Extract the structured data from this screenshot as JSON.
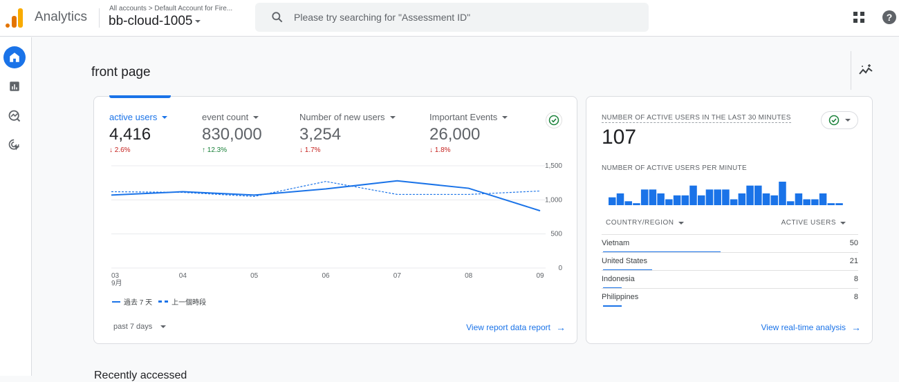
{
  "header": {
    "app_name": "Analytics",
    "breadcrumb": "All accounts > Default Account for Fire...",
    "property": "bb-cloud-1005",
    "search_placeholder": "Please try searching for \"Assessment ID\"",
    "icons": [
      "analytics-logo",
      "search-icon",
      "apps-icon",
      "help-icon"
    ]
  },
  "sidenav": {
    "items": [
      {
        "name": "home",
        "icon": "home-icon",
        "active": true
      },
      {
        "name": "reports",
        "icon": "bar-chart-icon",
        "active": false
      },
      {
        "name": "explore",
        "icon": "explore-icon",
        "active": false
      },
      {
        "name": "advertising",
        "icon": "target-cursor-icon",
        "active": false
      }
    ]
  },
  "page": {
    "title": "front page",
    "recent_heading": "Recently accessed"
  },
  "overview_card": {
    "metrics": [
      {
        "label": "active users",
        "value": "4,416",
        "delta": "2.6%",
        "direction": "down",
        "active": true
      },
      {
        "label": "event count",
        "value": "830,000",
        "delta": "12.3%",
        "direction": "up",
        "active": false
      },
      {
        "label": "Number of new users",
        "value": "3,254",
        "delta": "1.7%",
        "direction": "down",
        "active": false
      },
      {
        "label": "Important Events",
        "value": "26,000",
        "delta": "1.8%",
        "direction": "down",
        "active": false
      }
    ],
    "legend": {
      "current": "過去 7 天",
      "previous": "上一個時段"
    },
    "date_range": "past 7 days",
    "view_link": "View report data report",
    "arrows": {
      "down": "↓",
      "up": "↑",
      "right": "→"
    }
  },
  "chart_data": {
    "type": "line",
    "title": "",
    "x": [
      "03",
      "04",
      "05",
      "06",
      "07",
      "08",
      "09"
    ],
    "x_sublabel": "9月",
    "ylabel": "",
    "xlabel": "",
    "ylim": [
      0,
      1500
    ],
    "yticks": [
      0,
      500,
      1000,
      1500
    ],
    "ytick_labels": [
      "0",
      "500",
      "1,000",
      "1,500"
    ],
    "y_axis_side": "right",
    "grid": true,
    "legend_position": "bottom-left",
    "series": [
      {
        "name": "過去 7 天",
        "style": "solid",
        "color": "#1a73e8",
        "values": [
          1070,
          1120,
          1070,
          1160,
          1280,
          1170,
          840
        ]
      },
      {
        "name": "上一個時段",
        "style": "dashed",
        "color": "#1a73e8",
        "values": [
          1120,
          1110,
          1050,
          1270,
          1080,
          1080,
          1130
        ]
      }
    ]
  },
  "realtime_card": {
    "title": "NUMBER OF ACTIVE USERS IN THE LAST 30 MINUTES",
    "value": "107",
    "subtitle": "NUMBER OF ACTIVE USERS PER MINUTE",
    "per_minute": [
      4,
      6,
      2,
      1,
      8,
      8,
      6,
      3,
      5,
      5,
      10,
      5,
      8,
      8,
      8,
      3,
      6,
      10,
      10,
      6,
      5,
      12,
      2,
      6,
      3,
      3,
      6,
      1,
      1
    ],
    "table": {
      "col_country": "COUNTRY/REGION",
      "col_users": "ACTIVE USERS",
      "rows": [
        {
          "country": "Vietnam",
          "users": "50",
          "share": 1.0
        },
        {
          "country": "United States",
          "users": "21",
          "share": 0.42
        },
        {
          "country": "Indonesia",
          "users": "8",
          "share": 0.16
        },
        {
          "country": "Philippines",
          "users": "8",
          "share": 0.16
        }
      ]
    },
    "view_link": "View real-time analysis"
  },
  "colors": {
    "accent": "#1a73e8",
    "down": "#c5221f",
    "up": "#188038",
    "check": "#188038"
  }
}
